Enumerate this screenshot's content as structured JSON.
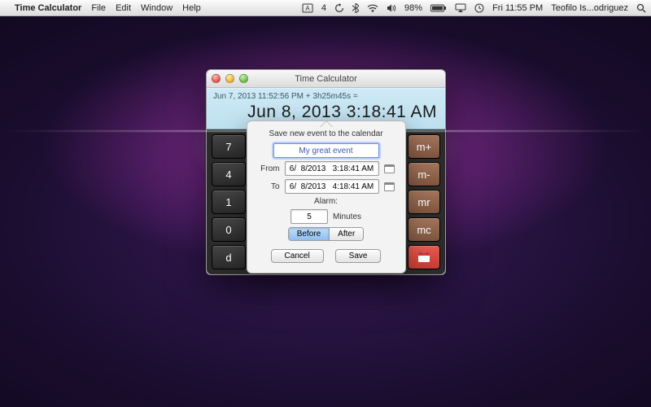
{
  "menubar": {
    "apple_glyph": "",
    "app_name": "Time Calculator",
    "items": [
      "File",
      "Edit",
      "Window",
      "Help"
    ],
    "status": {
      "adobe": "4",
      "battery": "98%",
      "clock": "Fri  11:55 PM",
      "user": "Teofilo Is...odriguez"
    }
  },
  "window": {
    "title": "Time Calculator",
    "display": {
      "expression": "Jun 7, 2013 11:52:56 PM + 3h25m45s =",
      "result": "Jun 8, 2013 3:18:41 AM"
    },
    "keys": {
      "col1": [
        "7",
        "4",
        "1",
        "0",
        "d"
      ],
      "mem": [
        "m+",
        "m-",
        "mr",
        "mc"
      ]
    }
  },
  "popover": {
    "heading": "Save new event to the calendar",
    "event_name": "My great event",
    "from_label": "From",
    "to_label": "To",
    "from_value": "6/  8/2013   3:18:41 AM",
    "to_value": "6/  8/2013   4:18:41 AM",
    "alarm_label": "Alarm:",
    "alarm_minutes": "5",
    "minutes_label": "Minutes",
    "seg_before": "Before",
    "seg_after": "After",
    "cancel": "Cancel",
    "save": "Save"
  }
}
